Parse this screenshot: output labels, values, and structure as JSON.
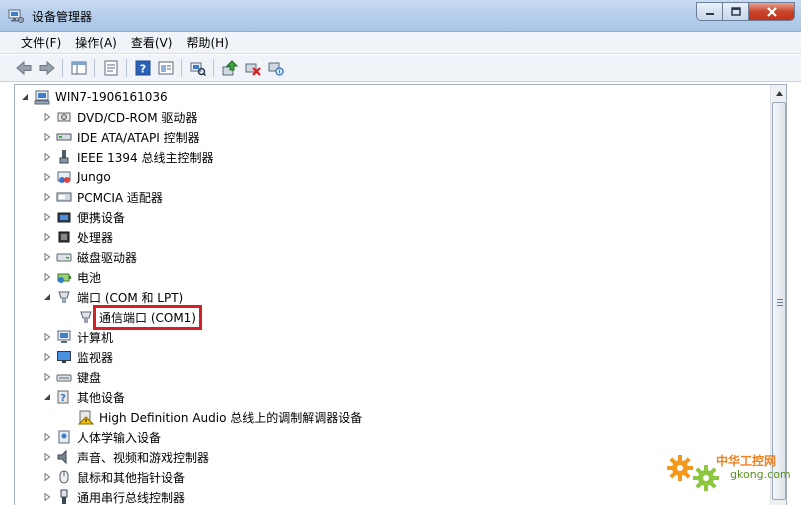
{
  "window": {
    "title": "设备管理器"
  },
  "menu": [
    "文件(F)",
    "操作(A)",
    "查看(V)",
    "帮助(H)"
  ],
  "toolbar": [
    {
      "name": "back-icon"
    },
    {
      "name": "forward-icon"
    },
    {
      "sep": true
    },
    {
      "name": "show-hide-icon"
    },
    {
      "sep": true
    },
    {
      "name": "properties-icon"
    },
    {
      "sep": true
    },
    {
      "name": "help-icon"
    },
    {
      "name": "view-icon"
    },
    {
      "sep": true
    },
    {
      "name": "scan-hardware-icon"
    },
    {
      "sep": true
    },
    {
      "name": "update-driver-icon"
    },
    {
      "name": "uninstall-icon"
    },
    {
      "name": "disable-icon"
    }
  ],
  "tree": {
    "root": "WIN7-1906161036",
    "nodes": [
      {
        "label": "DVD/CD-ROM 驱动器",
        "icon": "dvd-drive-icon",
        "expanded": false,
        "level": 1
      },
      {
        "label": "IDE ATA/ATAPI 控制器",
        "icon": "ide-controller-icon",
        "expanded": false,
        "level": 1
      },
      {
        "label": "IEEE 1394 总线主控制器",
        "icon": "ieee1394-icon",
        "expanded": false,
        "level": 1
      },
      {
        "label": "Jungo",
        "icon": "jungo-icon",
        "expanded": false,
        "level": 1
      },
      {
        "label": "PCMCIA 适配器",
        "icon": "pcmcia-icon",
        "expanded": false,
        "level": 1
      },
      {
        "label": "便携设备",
        "icon": "portable-device-icon",
        "expanded": false,
        "level": 1
      },
      {
        "label": "处理器",
        "icon": "processor-icon",
        "expanded": false,
        "level": 1
      },
      {
        "label": "磁盘驱动器",
        "icon": "disk-drive-icon",
        "expanded": false,
        "level": 1
      },
      {
        "label": "电池",
        "icon": "battery-icon",
        "expanded": false,
        "level": 1
      },
      {
        "label": "端口 (COM 和 LPT)",
        "icon": "port-icon",
        "expanded": true,
        "level": 1
      },
      {
        "label": "通信端口 (COM1)",
        "icon": "com-port-icon",
        "level": 2,
        "highlight": true
      },
      {
        "label": "计算机",
        "icon": "computer-icon",
        "expanded": false,
        "level": 1
      },
      {
        "label": "监视器",
        "icon": "monitor-icon",
        "expanded": false,
        "level": 1
      },
      {
        "label": "键盘",
        "icon": "keyboard-icon",
        "expanded": false,
        "level": 1
      },
      {
        "label": "其他设备",
        "icon": "other-devices-icon",
        "expanded": true,
        "level": 1
      },
      {
        "label": "High Definition Audio 总线上的调制解调器设备",
        "icon": "unknown-device-warning-icon",
        "level": 2
      },
      {
        "label": "人体学输入设备",
        "icon": "hid-icon",
        "expanded": false,
        "level": 1
      },
      {
        "label": "声音、视频和游戏控制器",
        "icon": "sound-icon",
        "expanded": false,
        "level": 1
      },
      {
        "label": "鼠标和其他指针设备",
        "icon": "mouse-icon",
        "expanded": false,
        "level": 1
      },
      {
        "label": "通用串行总线控制器",
        "icon": "usb-icon",
        "expanded": false,
        "level": 1
      }
    ]
  },
  "watermark": {
    "cn": "中华工控网",
    "en": "gkong.com"
  }
}
